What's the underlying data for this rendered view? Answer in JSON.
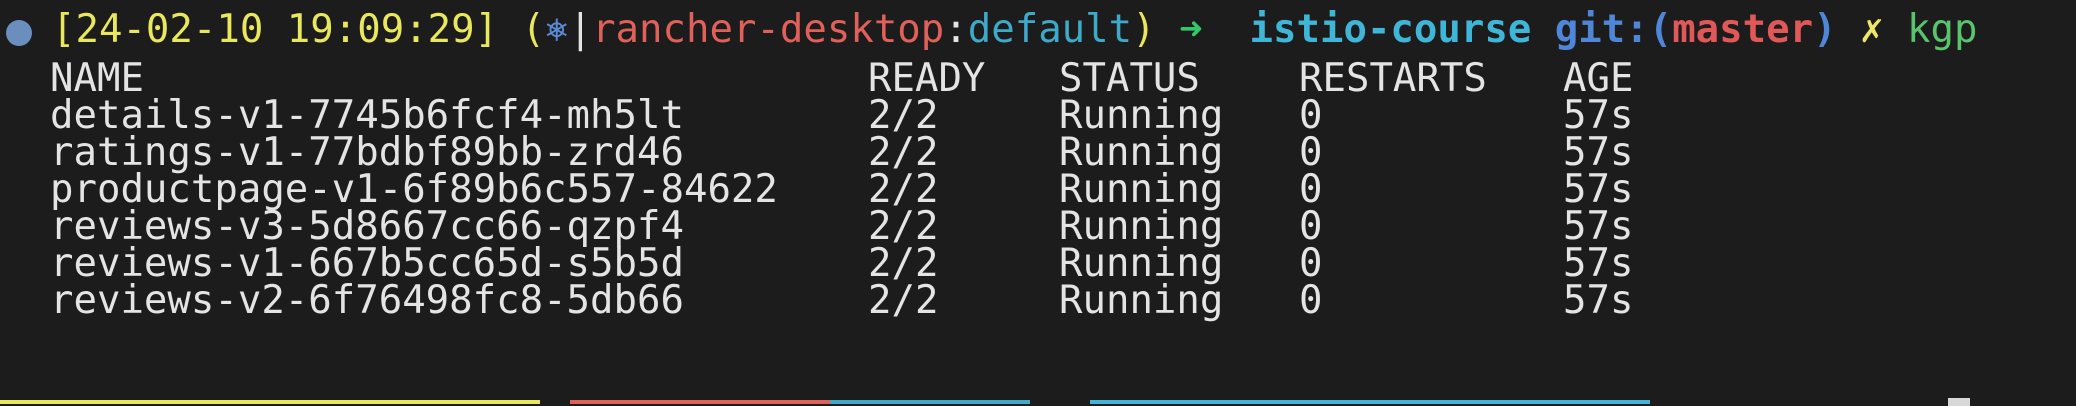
{
  "colors": {
    "background": "#1c1c1c",
    "text": "#e4e4e4",
    "timestamp": "#e9e85c",
    "k8s": "#5b8bd6",
    "context": "#e0605a",
    "namespace": "#3fa9c9",
    "arrow": "#33c96a",
    "repo": "#3fb6d8",
    "git": "#4f86d8",
    "branch": "#e05858",
    "dirty": "#eee66a",
    "command": "#58c46e",
    "marker": "#6a8fbf",
    "cursor": "#d8d8d8"
  },
  "prompt": {
    "timestamp": "[24-02-10 19:09:29]",
    "paren_open": "(",
    "k8s_icon": "⎈",
    "pipe": "|",
    "context": "rancher-desktop",
    "colon": ":",
    "namespace": "default",
    "paren_close": ")",
    "arrow": "➜",
    "repo": "istio-course",
    "git_label": "git:(",
    "branch": "master",
    "git_close": ")",
    "dirty_mark": "✗",
    "command": "kgp"
  },
  "table": {
    "headers": [
      "NAME",
      "READY",
      "STATUS",
      "RESTARTS",
      "AGE"
    ],
    "rows": [
      [
        "details-v1-7745b6fcf4-mh5lt",
        "2/2",
        "Running",
        "0",
        "57s"
      ],
      [
        "ratings-v1-77bdbf89bb-zrd46",
        "2/2",
        "Running",
        "0",
        "57s"
      ],
      [
        "productpage-v1-6f89b6c557-84622",
        "2/2",
        "Running",
        "0",
        "57s"
      ],
      [
        "reviews-v3-5d8667cc66-qzpf4",
        "2/2",
        "Running",
        "0",
        "57s"
      ],
      [
        "reviews-v1-667b5cc65d-s5b5d",
        "2/2",
        "Running",
        "0",
        "57s"
      ],
      [
        "reviews-v2-6f76498fc8-5db66",
        "2/2",
        "Running",
        "0",
        "57s"
      ]
    ]
  }
}
